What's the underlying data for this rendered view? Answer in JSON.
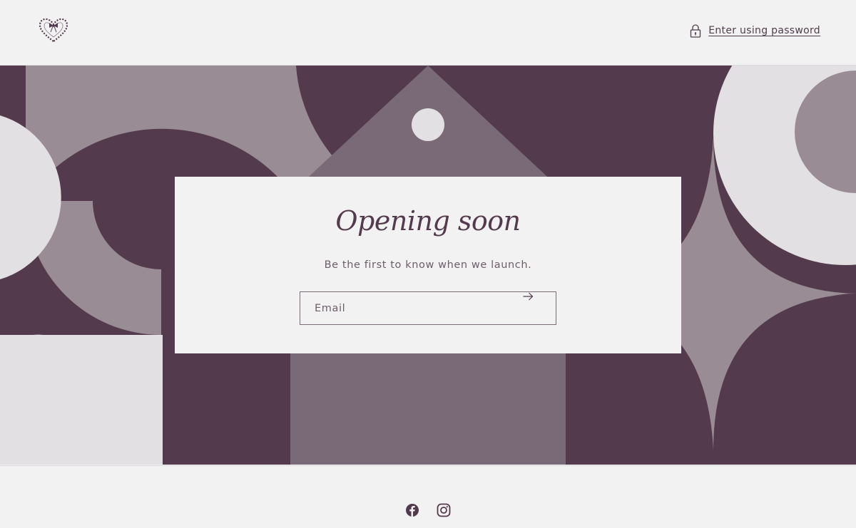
{
  "header": {
    "logo_icon": "heart-bow-logo-icon",
    "password_link_icon": "lock-icon",
    "password_link_label": "Enter using password"
  },
  "hero": {
    "colors": {
      "plum": "#533b4d",
      "mauve": "#9a8c95",
      "dusk": "#7a6a78",
      "pale": "#e2e0e2"
    }
  },
  "newsletter": {
    "title": "Opening soon",
    "subtitle": "Be the first to know when we launch.",
    "email_placeholder": "Email",
    "email_value": "",
    "submit_icon": "arrow-right-icon"
  },
  "footer": {
    "social": [
      {
        "name": "Facebook",
        "icon": "facebook-icon"
      },
      {
        "name": "Instagram",
        "icon": "instagram-icon"
      }
    ]
  },
  "theme": {
    "background": "#f3f2f2",
    "accent": "#533b4d"
  }
}
